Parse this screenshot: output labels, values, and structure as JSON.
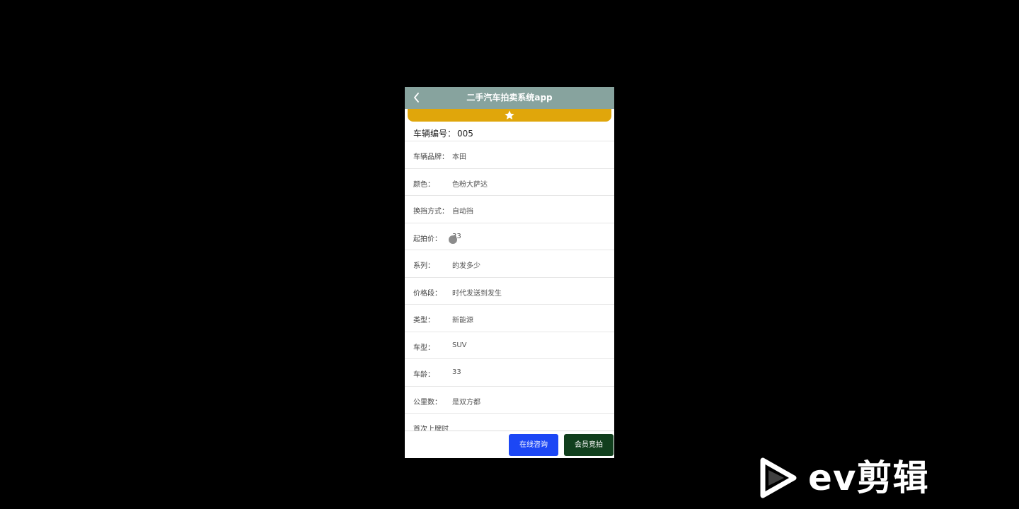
{
  "app": {
    "title": "二手汽车拍卖系统app"
  },
  "detail": {
    "vehicle_no_label": "车辆编号",
    "vehicle_no_sep": "：",
    "vehicle_no_value": "005",
    "rows": [
      {
        "label": "车辆品牌：",
        "value": "本田"
      },
      {
        "label": "颜色：",
        "value": "色粉大萨达"
      },
      {
        "label": "换挡方式：",
        "value": "自动挡"
      },
      {
        "label": "起拍价：",
        "value": "33"
      },
      {
        "label": "系列：",
        "value": "的发多少"
      },
      {
        "label": "价格段：",
        "value": "时代发送到发生"
      },
      {
        "label": "类型：",
        "value": "新能源"
      },
      {
        "label": "车型：",
        "value": "SUV"
      },
      {
        "label": "车龄：",
        "value": "33"
      },
      {
        "label": "公里数：",
        "value": "是双方都"
      },
      {
        "label": "首次上牌时",
        "value": ""
      }
    ]
  },
  "actions": {
    "consult_label": "在线咨询",
    "bid_label": "会员竞拍"
  },
  "watermark": {
    "text": "ev剪辑"
  },
  "colors": {
    "topbar": "#87a39e",
    "fav_bar": "#e0a60b",
    "consult_button": "#1c47f5",
    "bid_button": "#113f1d"
  },
  "icons": {
    "back": "chevron-left-icon",
    "favorite": "star-icon",
    "watermark_logo": "play-triangle-icon"
  }
}
